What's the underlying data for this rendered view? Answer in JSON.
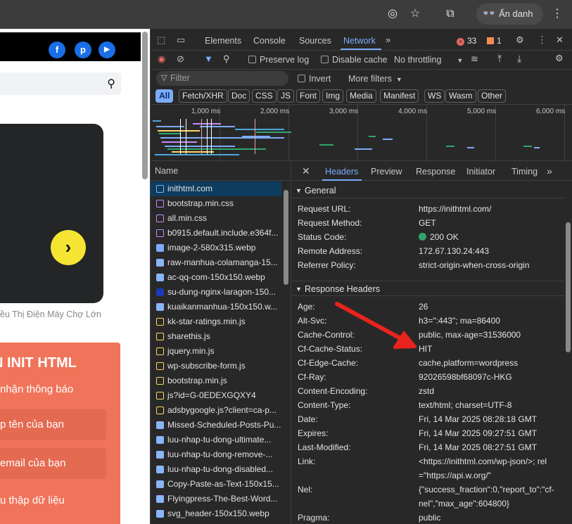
{
  "browser": {
    "incognito_label": "Ẩn danh",
    "icons": [
      "eye-off-icon",
      "star-icon",
      "extensions-icon",
      "incognito-icon",
      "more-vert-icon"
    ]
  },
  "site": {
    "social": [
      "f",
      "p",
      "▶"
    ],
    "caption": "ều Thị Điện Máy Chợ Lớn",
    "newsletter_title": "N INIT HTML",
    "newsletter_sub": "nhận thông báo",
    "field_name": "p tên của bạn",
    "field_email": "email của bạn",
    "footer_text": "u thập dữ liệu"
  },
  "devtools": {
    "tabs": [
      "Elements",
      "Console",
      "Sources",
      "Network"
    ],
    "active_tab": "Network",
    "error_count": "33",
    "warning_count": "1",
    "preserve_log": "Preserve log",
    "disable_cache": "Disable cache",
    "throttling": "No throttling",
    "filter_placeholder": "Filter",
    "invert": "Invert",
    "more_filters": "More filters",
    "chips": [
      "All",
      "Fetch/XHR",
      "Doc",
      "CSS",
      "JS",
      "Font",
      "Img",
      "Media",
      "Manifest",
      "WS",
      "Wasm",
      "Other"
    ],
    "timeline_ticks": [
      "1,000 ms",
      "2,000 ms",
      "3,000 ms",
      "4,000 ms",
      "5,000 ms",
      "6,000 ms"
    ],
    "name_header": "Name",
    "requests": [
      {
        "name": "inithtml.com",
        "type": "doc",
        "color": "#7cacf8"
      },
      {
        "name": "bootstrap.min.css",
        "type": "css",
        "color": "#c58af9"
      },
      {
        "name": "all.min.css",
        "type": "css",
        "color": "#c58af9"
      },
      {
        "name": "b0915.default.include.e364f...",
        "type": "css",
        "color": "#c58af9"
      },
      {
        "name": "image-2-580x315.webp",
        "type": "img",
        "color": "#7cacf8"
      },
      {
        "name": "raw-manhua-colamanga-15...",
        "type": "img",
        "color": "#8ab4f8"
      },
      {
        "name": "ac-qq-com-150x150.webp",
        "type": "img",
        "color": "#8ab4f8"
      },
      {
        "name": "su-dung-nginx-laragon-150...",
        "type": "img",
        "color": "#1a3bb3"
      },
      {
        "name": "kuaikanmanhua-150x150.w...",
        "type": "img",
        "color": "#8ab4f8"
      },
      {
        "name": "kk-star-ratings.min.js",
        "type": "js",
        "color": "#fdd663"
      },
      {
        "name": "sharethis.js",
        "type": "js",
        "color": "#fdd663"
      },
      {
        "name": "jquery.min.js",
        "type": "js",
        "color": "#fdd663"
      },
      {
        "name": "wp-subscribe-form.js",
        "type": "js",
        "color": "#fdd663"
      },
      {
        "name": "bootstrap.min.js",
        "type": "js",
        "color": "#fdd663"
      },
      {
        "name": "js?id=G-0EDEXGQXY4",
        "type": "js",
        "color": "#fdd663"
      },
      {
        "name": "adsbygoogle.js?client=ca-p...",
        "type": "js",
        "color": "#fdd663"
      },
      {
        "name": "Missed-Scheduled-Posts-Pu...",
        "type": "img",
        "color": "#8ab4f8"
      },
      {
        "name": "luu-nhap-tu-dong-ultimate...",
        "type": "img",
        "color": "#8ab4f8"
      },
      {
        "name": "luu-nhap-tu-dong-remove-...",
        "type": "img",
        "color": "#8ab4f8"
      },
      {
        "name": "luu-nhap-tu-dong-disabled...",
        "type": "img",
        "color": "#8ab4f8"
      },
      {
        "name": "Copy-Paste-as-Text-150x15...",
        "type": "img",
        "color": "#8ab4f8"
      },
      {
        "name": "Flyingpress-The-Best-Word...",
        "type": "img",
        "color": "#8ab4f8"
      },
      {
        "name": "svg_header-150x150.webp",
        "type": "img",
        "color": "#8ab4f8"
      }
    ],
    "detail_tabs": [
      "Headers",
      "Preview",
      "Response",
      "Initiator",
      "Timing"
    ],
    "general_title": "General",
    "general": [
      {
        "k": "Request URL:",
        "v": "https://inithtml.com/"
      },
      {
        "k": "Request Method:",
        "v": "GET"
      },
      {
        "k": "Status Code:",
        "v": "200 OK"
      },
      {
        "k": "Remote Address:",
        "v": "172.67.130.24:443"
      },
      {
        "k": "Referrer Policy:",
        "v": "strict-origin-when-cross-origin"
      }
    ],
    "response_title": "Response Headers",
    "response": [
      {
        "k": "Age:",
        "v": "26"
      },
      {
        "k": "Alt-Svc:",
        "v": "h3=\":443\"; ma=86400"
      },
      {
        "k": "Cache-Control:",
        "v": "public, max-age=31536000"
      },
      {
        "k": "Cf-Cache-Status:",
        "v": "HIT"
      },
      {
        "k": "Cf-Edge-Cache:",
        "v": "cache,platform=wordpress"
      },
      {
        "k": "Cf-Ray:",
        "v": "92026598bf68097c-HKG"
      },
      {
        "k": "Content-Encoding:",
        "v": "zstd"
      },
      {
        "k": "Content-Type:",
        "v": "text/html; charset=UTF-8"
      },
      {
        "k": "Date:",
        "v": "Fri, 14 Mar 2025 08:28:18 GMT"
      },
      {
        "k": "Expires:",
        "v": "Fri, 14 Mar 2025 09:27:51 GMT"
      },
      {
        "k": "Last-Modified:",
        "v": "Fri, 14 Mar 2025 08:27:51 GMT"
      },
      {
        "k": "Link:",
        "v": "<https://inithtml.com/wp-json/>; rel=\"https://api.w.org/\""
      },
      {
        "k": "Nel:",
        "v": "{\"success_fraction\":0,\"report_to\":\"cf-nel\",\"max_age\":604800}"
      },
      {
        "k": "Pragma:",
        "v": "public"
      }
    ]
  }
}
